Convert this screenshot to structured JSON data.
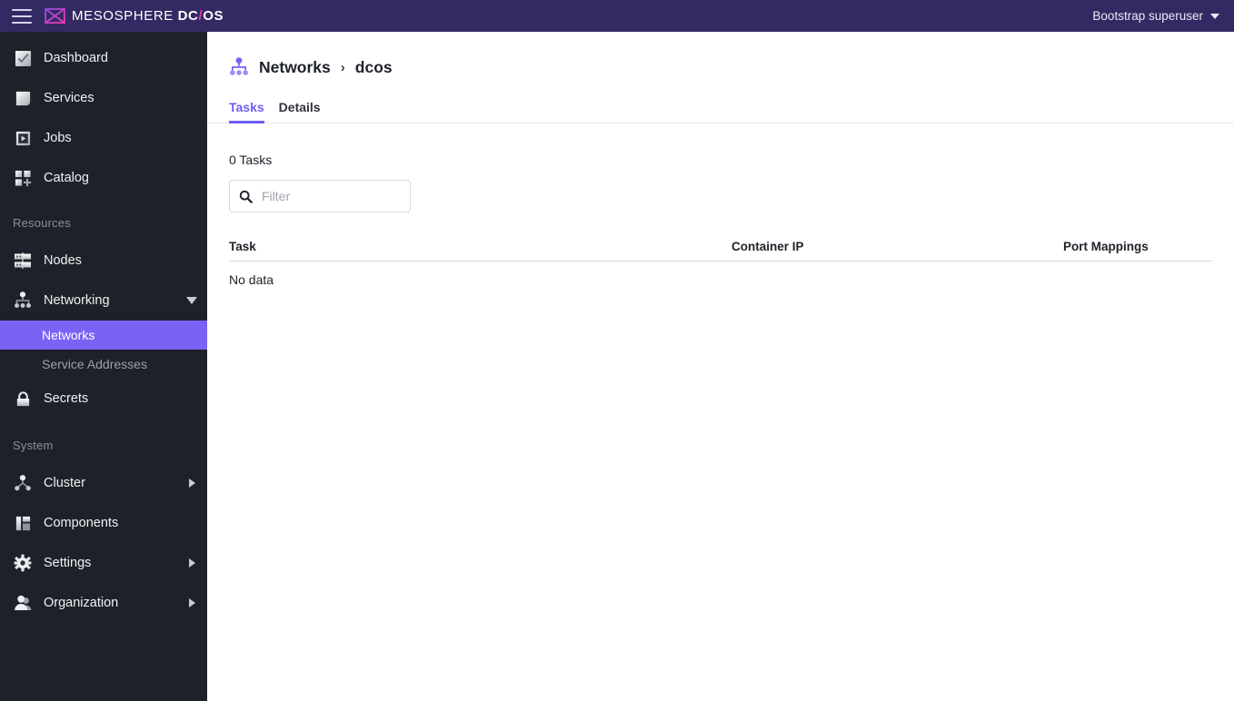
{
  "header": {
    "menu_icon": "hamburger-icon",
    "brand_prefix": "MESOSPHERE ",
    "brand_dc": "DC",
    "brand_slash": "/",
    "brand_os": "OS",
    "user_label": "Bootstrap superuser",
    "user_caret_icon": "chevron-down-icon",
    "background": "#342a63",
    "accent": "#e83bb0"
  },
  "sidebar": {
    "background": "#1e2129",
    "active_color": "#7b62f5",
    "primary_items": [
      {
        "label": "Dashboard",
        "icon": "dashboard-check-icon"
      },
      {
        "label": "Services",
        "icon": "services-square-icon"
      },
      {
        "label": "Jobs",
        "icon": "jobs-play-icon"
      },
      {
        "label": "Catalog",
        "icon": "catalog-grid-plus-icon"
      }
    ],
    "resources_title": "Resources",
    "resources_items": [
      {
        "label": "Nodes",
        "icon": "nodes-server-icon",
        "expandable": false
      },
      {
        "label": "Networking",
        "icon": "networking-tree-icon",
        "expandable": true,
        "expanded": true
      },
      {
        "label": "Secrets",
        "icon": "secrets-lock-icon",
        "expandable": false
      }
    ],
    "networking_children": [
      {
        "label": "Networks",
        "active": true
      },
      {
        "label": "Service Addresses",
        "active": false
      }
    ],
    "system_title": "System",
    "system_items": [
      {
        "label": "Cluster",
        "icon": "cluster-nodes-icon",
        "expandable": true
      },
      {
        "label": "Components",
        "icon": "components-bars-icon",
        "expandable": false
      },
      {
        "label": "Settings",
        "icon": "settings-gear-icon",
        "expandable": true
      },
      {
        "label": "Organization",
        "icon": "organization-user-icon",
        "expandable": true
      }
    ]
  },
  "main": {
    "breadcrumb": {
      "icon": "networking-tree-icon",
      "root": "Networks",
      "separator": "›",
      "current": "dcos"
    },
    "tabs": [
      {
        "label": "Tasks",
        "active": true
      },
      {
        "label": "Details",
        "active": false
      }
    ],
    "tab_accent": "#6d5ef0",
    "task_count_label": "0 Tasks",
    "filter": {
      "icon": "search-icon",
      "value": "",
      "placeholder": "Filter"
    },
    "table": {
      "columns": [
        "Task",
        "Container IP",
        "Port Mappings"
      ],
      "rows": [],
      "empty_text": "No data"
    }
  }
}
